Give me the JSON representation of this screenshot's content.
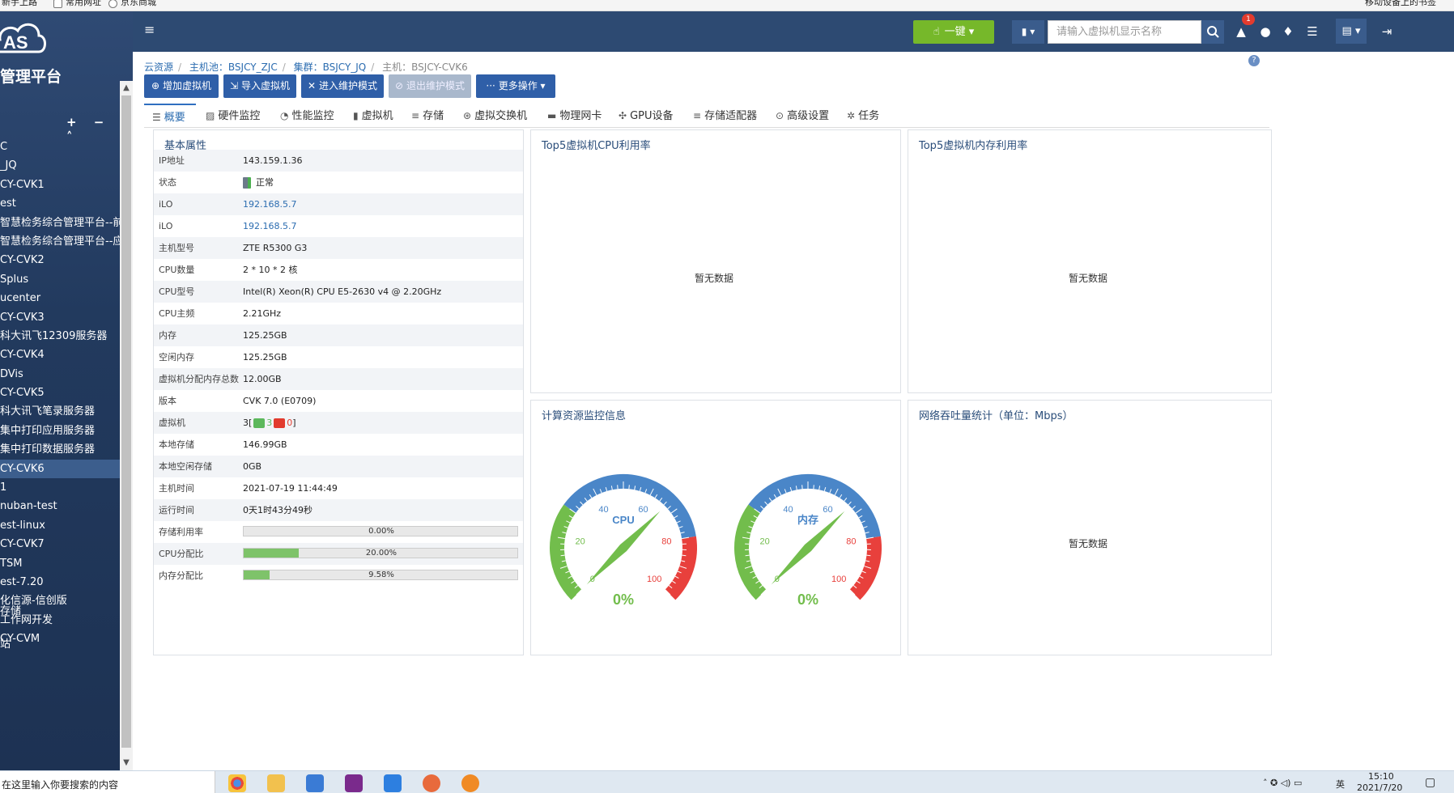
{
  "bookmarks": [
    "新手上路",
    "常用网址",
    "京东商城",
    "移动设备上的书签"
  ],
  "app": {
    "logo_text": "AS",
    "title": "管理平台"
  },
  "tree": {
    "tools": "+ − ˄",
    "items": [
      "C",
      "_JQ",
      "CY-CVK1",
      "est",
      "智慧检务综合管理平台--前端",
      "智慧检务综合管理平台--应用",
      "CY-CVK2",
      "Splus",
      "ucenter",
      "CY-CVK3",
      "科大讯飞12309服务器",
      "CY-CVK4",
      "DVis",
      "CY-CVK5",
      "科大讯飞笔录服务器",
      "集中打印应用服务器",
      "集中打印数据服务器",
      "CY-CVK6",
      "1",
      "nuban-test",
      "est-linux",
      "CY-CVK7",
      "TSM",
      "est-7.20",
      "化信源-信创版",
      "工作网开发",
      "CY-CVM"
    ],
    "active_index": 17,
    "extra": [
      "存储",
      "站"
    ]
  },
  "topbar": {
    "onekey_label": "一键",
    "search_placeholder": "请输入虚拟机显示名称",
    "alert_count": "1"
  },
  "breadcrumb": [
    {
      "label": "云资源",
      "link": true
    },
    {
      "label": "主机池：BSJCY_ZJC",
      "link": true
    },
    {
      "label": "集群：BSJCY_JQ",
      "link": true
    },
    {
      "label": "主机：BSJCY-CVK6",
      "link": false
    }
  ],
  "actions": [
    {
      "label": "增加虚拟机",
      "icon": "plus-circle-icon",
      "disabled": false
    },
    {
      "label": "导入虚拟机",
      "icon": "import-icon",
      "disabled": false
    },
    {
      "label": "进入维护模式",
      "icon": "wrench-icon",
      "disabled": false
    },
    {
      "label": "退出维护模式",
      "icon": "exit-maintenance-icon",
      "disabled": true
    },
    {
      "label": "更多操作",
      "icon": "more-icon",
      "disabled": false
    }
  ],
  "tabs": [
    "概要",
    "硬件监控",
    "性能监控",
    "虚拟机",
    "存储",
    "虚拟交换机",
    "物理网卡",
    "GPU设备",
    "存储适配器",
    "高级设置",
    "任务"
  ],
  "basic": {
    "title": "基本属性",
    "rows": [
      {
        "k": "IP地址",
        "v": "143.159.1.36"
      },
      {
        "k": "状态",
        "v": "正常"
      },
      {
        "k": "iLO",
        "v": "192.168.5.7",
        "link": true
      },
      {
        "k": "iLO",
        "v": "192.168.5.7",
        "link": true
      },
      {
        "k": "主机型号",
        "v": "ZTE R5300 G3"
      },
      {
        "k": "CPU数量",
        "v": "2 * 10 * 2 核"
      },
      {
        "k": "CPU型号",
        "v": "Intel(R) Xeon(R) CPU E5-2630 v4 @ 2.20GHz"
      },
      {
        "k": "CPU主频",
        "v": "2.21GHz"
      },
      {
        "k": "内存",
        "v": "125.25GB"
      },
      {
        "k": "空闲内存",
        "v": "125.25GB"
      },
      {
        "k": "虚拟机分配内存总数",
        "v": "12.00GB"
      },
      {
        "k": "版本",
        "v": "CVK 7.0 (E0709)"
      },
      {
        "k": "虚拟机",
        "v": "3[",
        "running": "3",
        "stopped": "0",
        "close": "]"
      },
      {
        "k": "本地存储",
        "v": "146.99GB"
      },
      {
        "k": "本地空闲存储",
        "v": "0GB"
      },
      {
        "k": "主机时间",
        "v": "2021-07-19 11:44:49"
      },
      {
        "k": "运行时间",
        "v": "0天1时43分49秒"
      }
    ],
    "bars": [
      {
        "k": "存储利用率",
        "text": "0.00%",
        "value": 0.0
      },
      {
        "k": "CPU分配比",
        "text": "20.00%",
        "value": 20.0
      },
      {
        "k": "内存分配比",
        "text": "9.58%",
        "value": 9.58
      }
    ]
  },
  "panels": {
    "cpu_top5": {
      "title": "Top5虚拟机CPU利用率",
      "empty": "暂无数据"
    },
    "mem_top5": {
      "title": "Top5虚拟机内存利用率",
      "empty": "暂无数据"
    },
    "compute": {
      "title": "计算资源监控信息"
    },
    "network": {
      "title": "网络吞吐量统计（单位：Mbps）",
      "empty": "暂无数据"
    }
  },
  "gauges": [
    {
      "label": "CPU",
      "value_text": "0%",
      "value": 0,
      "ticks": [
        "0",
        "20",
        "40",
        "60",
        "80",
        "100"
      ]
    },
    {
      "label": "内存",
      "value_text": "0%",
      "value": 0,
      "ticks": [
        "0",
        "20",
        "40",
        "60",
        "80",
        "100"
      ]
    }
  ],
  "colors": {
    "header": "#2d4a72",
    "accent": "#2f5fa8",
    "green": "#76b82a",
    "gauge_blue": "#4a86c8",
    "gauge_green": "#72bd4c",
    "gauge_red": "#e8403c"
  },
  "taskbar": {
    "search": "在这里输入你要搜索的内容",
    "time": "15:10",
    "date": "2021/7/20",
    "lang": "英"
  }
}
